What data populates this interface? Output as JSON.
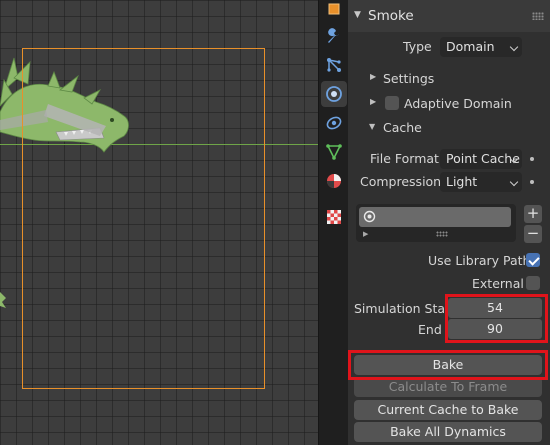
{
  "viewport": {
    "label": "3D Viewport"
  },
  "tabs": [
    {
      "icon": "object-data-icon",
      "active": false
    },
    {
      "icon": "wrench-modifier-icon",
      "active": false
    },
    {
      "icon": "particles-icon",
      "active": false
    },
    {
      "icon": "physics-icon",
      "active": true
    },
    {
      "icon": "object-constraint-icon",
      "active": false
    },
    {
      "icon": "mesh-data-icon",
      "active": false
    },
    {
      "icon": "material-icon",
      "active": false
    },
    {
      "icon": "texture-icon",
      "active": false
    }
  ],
  "panel": {
    "title": "Smoke",
    "type_label": "Type",
    "type_value": "Domain",
    "settings_label": "Settings",
    "adaptive_domain_label": "Adaptive Domain",
    "adaptive_domain_checked": false,
    "cache_label": "Cache",
    "file_format_label": "File Format",
    "file_format_value": "Point Cache",
    "compression_label": "Compression",
    "compression_value": "Light",
    "cache_list_add": "+",
    "cache_list_remove": "−",
    "use_library_path_label": "Use Library Path",
    "use_library_path_checked": true,
    "external_label": "External",
    "external_checked": false,
    "simulation_start_label": "Simulation Start",
    "simulation_start_value": "54",
    "end_label": "End",
    "end_value": "90",
    "bake_label": "Bake",
    "calculate_to_frame_label": "Calculate To Frame",
    "current_cache_to_bake_label": "Current Cache to Bake",
    "bake_all_dynamics_label": "Bake All Dynamics"
  },
  "colors": {
    "highlight": "#e0141b",
    "camera_frame": "#e8902a",
    "accent_checkbox": "#4772b3"
  }
}
